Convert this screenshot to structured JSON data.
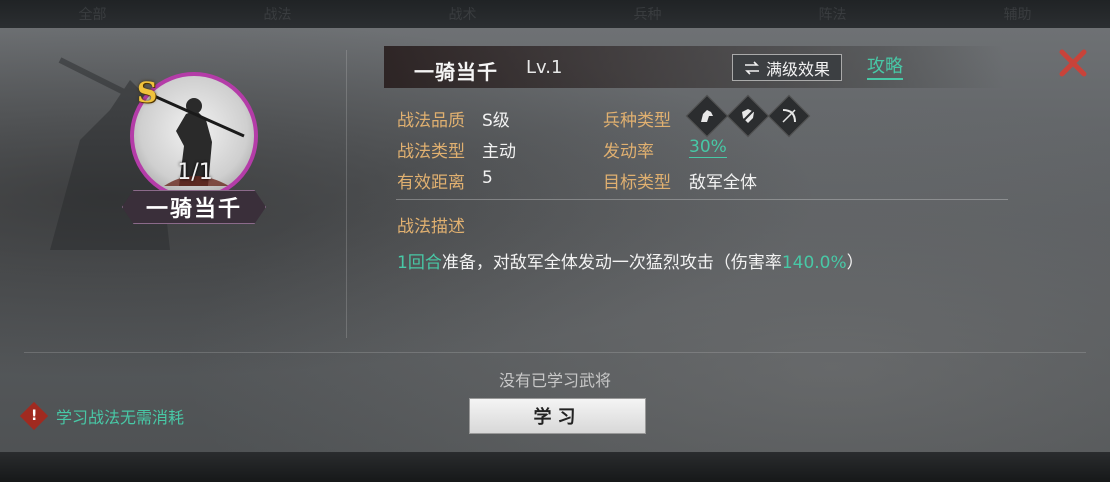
{
  "top_tabs": [
    "全部",
    "战法",
    "战术",
    "兵种",
    "阵法",
    "辅助"
  ],
  "skill": {
    "rank": "S",
    "count": "1/1",
    "name": "一骑当千",
    "level": "Lv.1",
    "max_effect_label": "满级效果",
    "max_effect_icon": "swap-arrows-icon",
    "guide_label": "攻略"
  },
  "info": {
    "quality_label": "战法品质",
    "quality_value": "S级",
    "type_label": "战法类型",
    "type_value": "主动",
    "range_label": "有效距离",
    "range_value": "5",
    "troop_label": "兵种类型",
    "troop_icons": [
      "cavalry-icon",
      "shield-icon",
      "archer-icon"
    ],
    "rate_label": "发动率",
    "rate_value": "30%",
    "target_label": "目标类型",
    "target_value": "敌军全体"
  },
  "description": {
    "title": "战法描述",
    "turns": "1回合",
    "text_a": "准备，对敌军全体发动一次猛烈攻击（伤害率",
    "damage": "140.0%",
    "text_b": "）"
  },
  "footer": {
    "no_general": "没有已学习武将",
    "learn_label": "学习",
    "hint": "学习战法无需消耗",
    "hint_icon": "warning-icon"
  },
  "colors": {
    "accent_green": "#48c8a6",
    "label_gold": "#e0b070",
    "rank_gold": "#f0c23c",
    "portrait_border": "#b43ca8",
    "close_red": "#c8433a"
  }
}
